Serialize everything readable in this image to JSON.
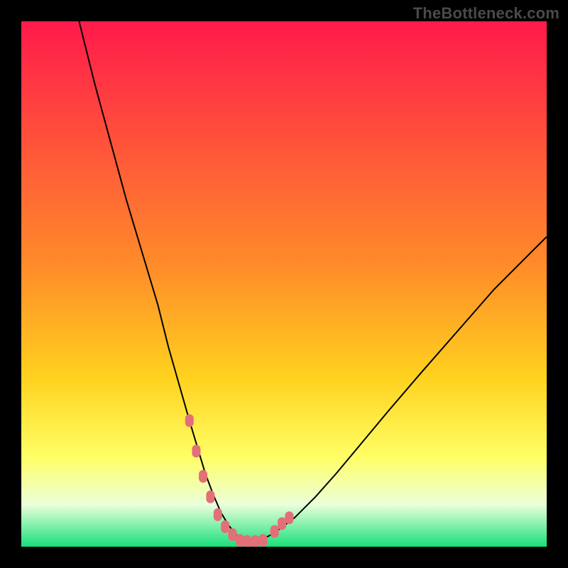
{
  "watermark": "TheBottleneck.com",
  "colors": {
    "frame_bg": "#000000",
    "grad_top": "#ff1a4b",
    "grad_mid": "#ffd21e",
    "grad_low": "#ffff66",
    "grad_bottom_pale": "#eaffda",
    "grad_bottom_green": "#18e07a",
    "curve": "#000000",
    "marker": "#e36f79"
  },
  "chart_data": {
    "type": "line",
    "title": "",
    "xlabel": "",
    "ylabel": "",
    "xlim": [
      0,
      100
    ],
    "ylim": [
      0,
      100
    ],
    "series": [
      {
        "name": "bottleneck-curve",
        "x": [
          11,
          14,
          17,
          20,
          23,
          26,
          28,
          30,
          32,
          33.5,
          35,
          36.5,
          38,
          39.5,
          41,
          43,
          45,
          48,
          52,
          56,
          60,
          65,
          70,
          76,
          83,
          90,
          97,
          100
        ],
        "y": [
          100,
          88,
          77,
          66,
          56,
          46,
          38,
          31,
          24,
          19,
          14,
          10,
          6.5,
          4,
          2.2,
          1.0,
          1.0,
          2.5,
          5.5,
          9.5,
          14,
          20,
          26,
          33,
          41,
          49,
          56,
          59
        ]
      }
    ],
    "markers": {
      "name": "highlighted-range",
      "x": [
        32.0,
        33.3,
        34.6,
        36.0,
        37.4,
        38.8,
        40.2,
        41.6,
        43.0,
        44.5,
        46.0,
        48.2,
        49.6,
        51.0
      ],
      "y": [
        24.0,
        18.2,
        13.4,
        9.5,
        6.1,
        3.8,
        2.3,
        1.2,
        1.0,
        1.0,
        1.2,
        2.9,
        4.4,
        5.5
      ]
    }
  }
}
